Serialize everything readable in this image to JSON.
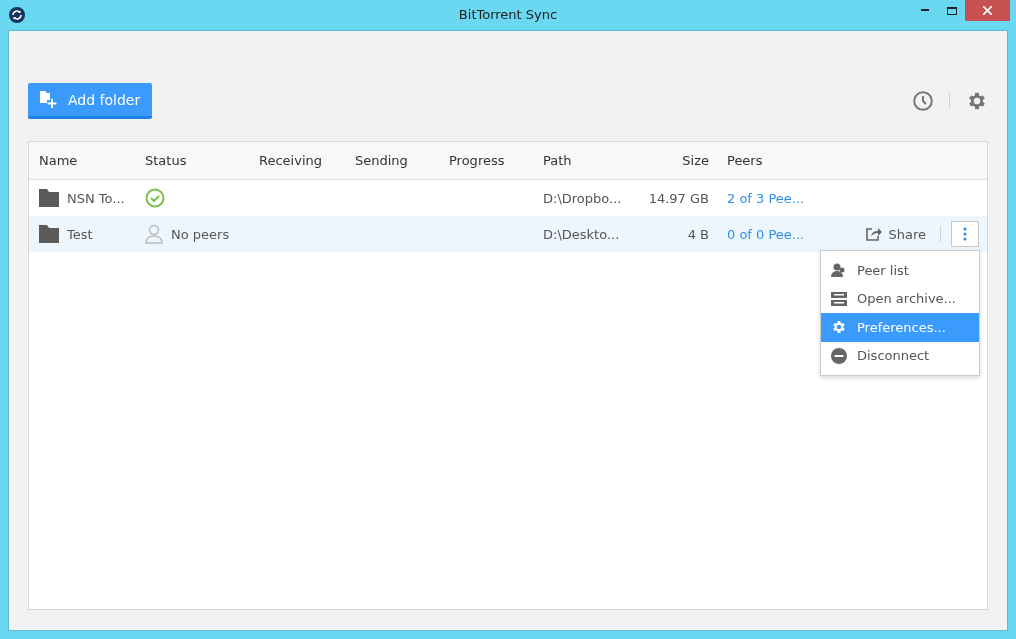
{
  "window": {
    "title": "BitTorrent Sync"
  },
  "toolbar": {
    "add_button": "Add folder"
  },
  "table": {
    "columns": [
      "Name",
      "Status",
      "Receiving",
      "Sending",
      "Progress",
      "Path",
      "Size",
      "Peers"
    ],
    "rows": [
      {
        "name": "NSN To...",
        "status": {
          "kind": "synced"
        },
        "path": "D:\\Dropbo...",
        "size": "14.97 GB",
        "peers": "2 of 3 Pee...",
        "selected": false
      },
      {
        "name": "Test",
        "status": {
          "kind": "no-peers",
          "text": "No peers"
        },
        "path": "D:\\Deskto...",
        "size": "4 B",
        "peers": "0 of 0 Pee...",
        "selected": true,
        "share": "Share"
      }
    ]
  },
  "menu": {
    "items": [
      {
        "kind": "peers",
        "label": "Peer list",
        "selected": false
      },
      {
        "kind": "archive",
        "label": "Open archive...",
        "selected": false
      },
      {
        "kind": "preferences",
        "label": "Preferences...",
        "selected": true
      },
      {
        "kind": "disconnect",
        "label": "Disconnect",
        "selected": false
      }
    ]
  }
}
